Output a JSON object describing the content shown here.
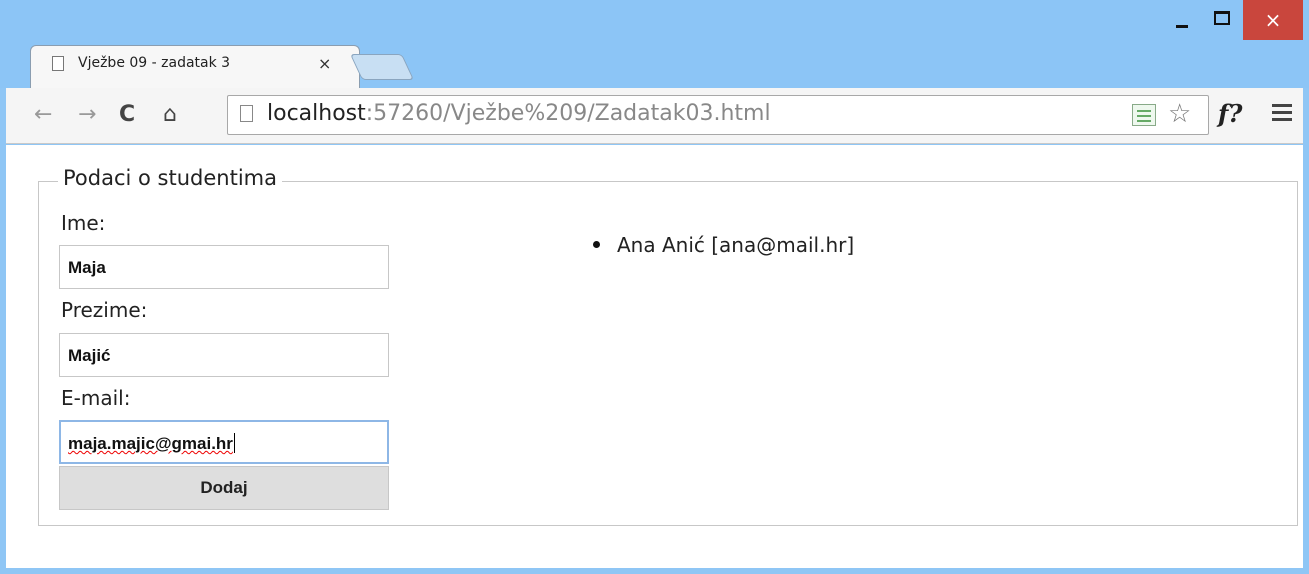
{
  "window": {
    "minimize": "_",
    "maximize": "□",
    "close": "×"
  },
  "tab": {
    "title": "Vježbe 09 - zadatak 3",
    "close": "×"
  },
  "toolbar": {
    "back": "←",
    "forward": "→",
    "reload": "C",
    "home": "⌂",
    "url_host": "localhost",
    "url_rest": ":57260/Vježbe%209/Zadatak03.html",
    "star": "☆",
    "ext": "f?"
  },
  "form": {
    "legend": "Podaci o studentima",
    "ime_label": "Ime:",
    "ime_value": "Maja",
    "prezime_label": "Prezime:",
    "prezime_value": "Majić",
    "email_label": "E-mail:",
    "email_value": "maja.majic@gmai.hr",
    "submit_label": "Dodaj"
  },
  "students": [
    {
      "text": "Ana Anić [ana@mail.hr]"
    }
  ],
  "colors": {
    "titlebar": "#8cc5f6",
    "close_button": "#c9463d",
    "focus_border": "#8eb7e6"
  }
}
